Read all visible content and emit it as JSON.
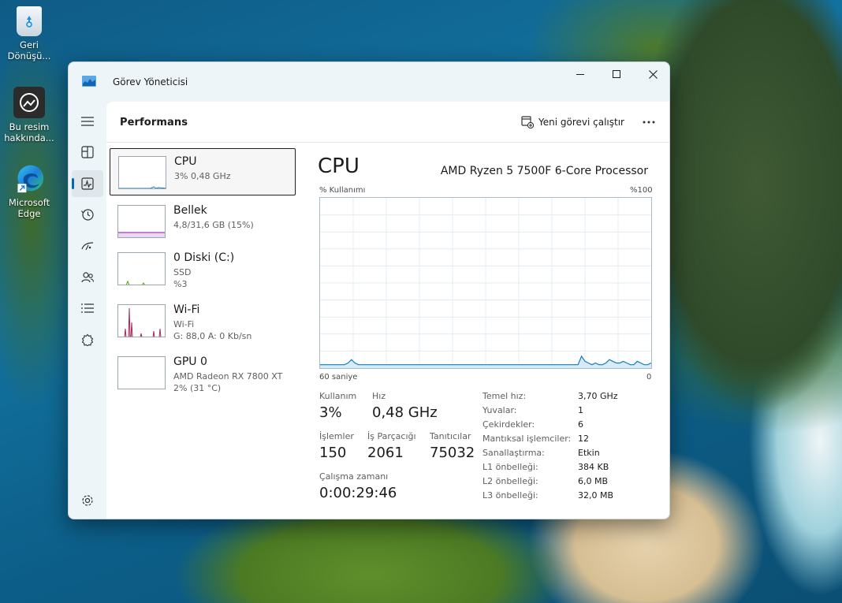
{
  "desktop": {
    "icons": [
      {
        "label": "Geri Dönüşü..."
      },
      {
        "label": "Bu resim hakkında..."
      },
      {
        "label": "Microsoft Edge"
      }
    ]
  },
  "window": {
    "title": "Görev Yöneticisi",
    "page_title": "Performans",
    "run_task_label": "Yeni görevi çalıştır"
  },
  "devices": [
    {
      "name": "CPU",
      "line1": "3% 0,48 GHz",
      "line2": ""
    },
    {
      "name": "Bellek",
      "line1": "4,8/31,6 GB (15%)",
      "line2": ""
    },
    {
      "name": "0 Diski (C:)",
      "line1": "SSD",
      "line2": "%3"
    },
    {
      "name": "Wi-Fi",
      "line1": "Wi-Fi",
      "line2": "G: 88,0 A: 0 Kb/sn"
    },
    {
      "name": "GPU 0",
      "line1": "AMD  Radeon RX 7800 XT",
      "line2": "2% (31 °C)"
    }
  ],
  "detail": {
    "title": "CPU",
    "model": "AMD Ryzen 5 7500F 6-Core Processor",
    "usage_label": "% Kullanımı",
    "max_label": "%100",
    "time_label": "60 saniye",
    "min_label": "0",
    "usage_history": [
      2,
      2,
      2,
      2,
      2,
      2,
      2,
      2,
      3,
      5,
      3,
      2,
      2,
      2,
      2,
      2,
      2,
      2,
      2,
      2,
      2,
      2,
      2,
      2,
      2,
      2,
      2,
      2,
      2,
      2,
      2,
      2,
      2,
      2,
      2,
      2,
      2,
      2,
      2,
      2,
      2,
      2,
      2,
      2,
      2,
      2,
      2,
      2,
      2,
      2,
      2,
      2,
      2,
      2,
      2,
      2,
      2,
      2,
      2,
      2,
      2,
      2,
      2,
      2,
      2,
      2,
      2,
      2,
      2,
      2,
      2,
      2,
      2,
      2,
      2,
      7,
      4,
      3,
      2,
      3,
      2,
      2,
      3,
      5,
      4,
      3,
      3,
      4,
      3,
      2,
      2,
      4,
      3,
      2,
      2,
      3
    ],
    "stats": {
      "usage_label": "Kullanım",
      "usage_value": "3%",
      "speed_label": "Hız",
      "speed_value": "0,48 GHz",
      "processes_label": "İşlemler",
      "processes_value": "150",
      "threads_label": "İş Parçacığı",
      "threads_value": "2061",
      "handles_label": "Tanıtıcılar",
      "handles_value": "75032",
      "uptime_label": "Çalışma zamanı",
      "uptime_value": "0:00:29:46"
    },
    "specs": [
      {
        "key": "Temel hız:",
        "value": "3,70 GHz"
      },
      {
        "key": "Yuvalar:",
        "value": "1"
      },
      {
        "key": "Çekirdekler:",
        "value": "6"
      },
      {
        "key": "Mantıksal işlemciler:",
        "value": "12"
      },
      {
        "key": "Sanallaştırma:",
        "value": "Etkin"
      },
      {
        "key": "L1 önbelleği:",
        "value": "384 KB"
      },
      {
        "key": "L2 önbelleği:",
        "value": "6,0 MB"
      },
      {
        "key": "L3 önbelleği:",
        "value": "32,0 MB"
      }
    ]
  },
  "colors": {
    "cpu_line": "#117dbb",
    "cpu_fill": "#d8eaf5",
    "wifi_line": "#a4275c",
    "disk_line": "#4da60c",
    "accent": "#0067c0"
  }
}
